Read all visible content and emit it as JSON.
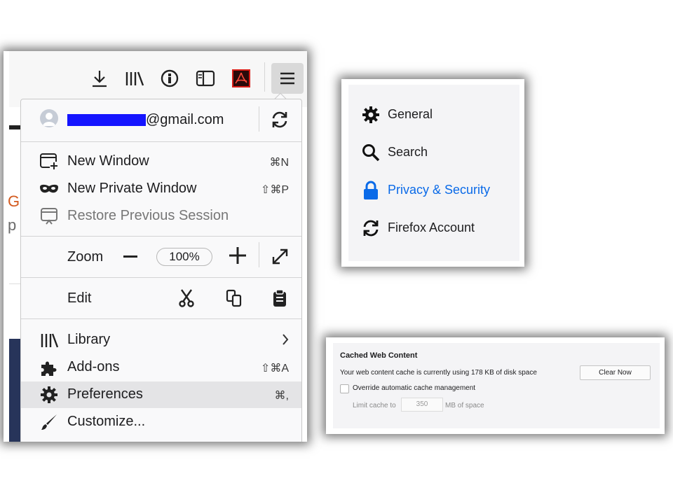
{
  "firefox_menu": {
    "toolbar_icons": [
      "download-icon",
      "library-icon",
      "info-icon",
      "sidebar-icon",
      "pdf-icon",
      "hamburger-menu-icon"
    ],
    "account": {
      "email_visible_suffix": "@gmail.com",
      "sync_icon": "sync-icon"
    },
    "items": [
      {
        "label": "New Window",
        "shortcut": "⌘N",
        "icon": "new-window-icon"
      },
      {
        "label": "New Private Window",
        "shortcut": "⇧⌘P",
        "icon": "private-mask-icon"
      },
      {
        "label": "Restore Previous Session",
        "shortcut": "",
        "icon": "restore-session-icon",
        "disabled": true
      }
    ],
    "zoom": {
      "label": "Zoom",
      "value": "100%"
    },
    "edit": {
      "label": "Edit"
    },
    "bottom_items": [
      {
        "label": "Library",
        "shortcut": "",
        "icon": "library-icon"
      },
      {
        "label": "Add-ons",
        "shortcut": "⇧⌘A",
        "icon": "puzzle-icon"
      },
      {
        "label": "Preferences",
        "shortcut": "⌘,",
        "icon": "gear-icon",
        "highlighted": true
      },
      {
        "label": "Customize...",
        "shortcut": "",
        "icon": "paintbrush-icon"
      }
    ],
    "page_behind": {
      "letter_1": "G",
      "letter_2": "p"
    }
  },
  "preferences_sidebar": {
    "categories": [
      {
        "label": "General",
        "icon": "gear-icon"
      },
      {
        "label": "Search",
        "icon": "search-icon"
      },
      {
        "label": "Privacy & Security",
        "icon": "lock-icon",
        "selected": true
      },
      {
        "label": "Firefox Account",
        "icon": "sync-icon"
      }
    ],
    "accent_color": "#0a6ae8"
  },
  "cache_settings": {
    "title": "Cached Web Content",
    "usage_text": "Your web content cache is currently using 178 KB of disk space",
    "clear_button": "Clear Now",
    "override_label": "Override automatic cache management",
    "override_checked": false,
    "limit_label": "Limit cache to",
    "limit_value": "350",
    "limit_unit": "MB of space"
  }
}
